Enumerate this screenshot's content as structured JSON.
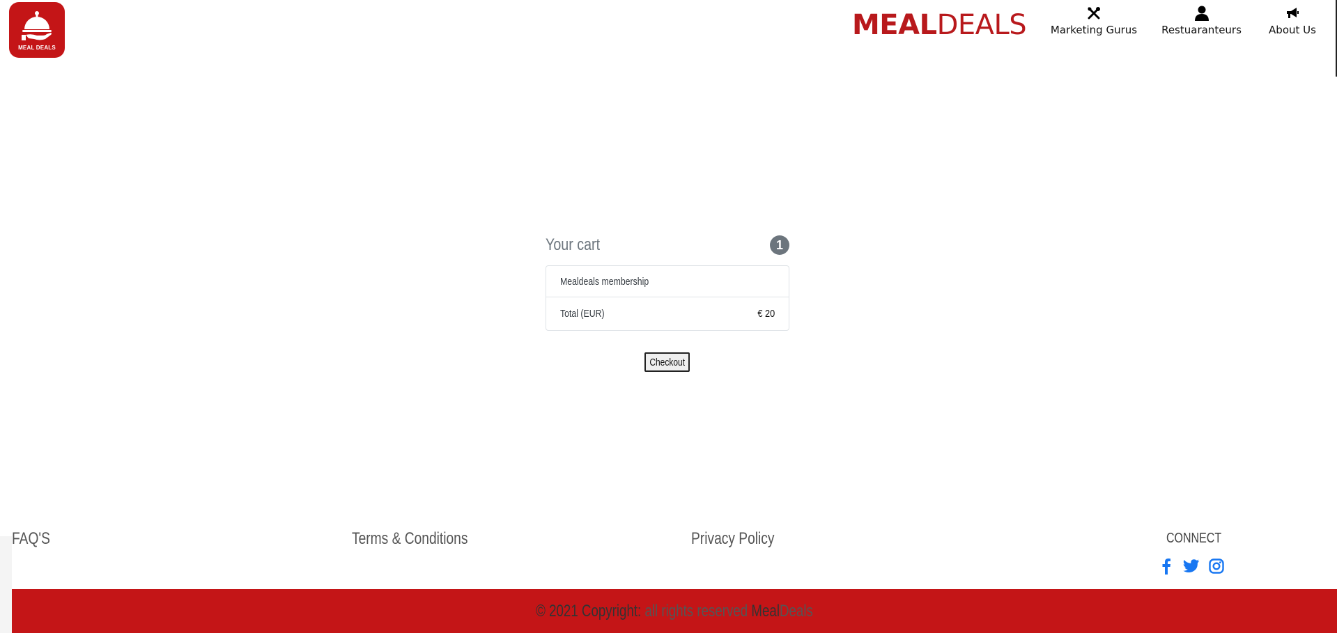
{
  "header": {
    "logo_text": "MEAL DEALS",
    "brand_part1": "MEAL",
    "brand_part2": "DEALS",
    "nav": [
      {
        "label": "Marketing Gurus",
        "icon": "tools-icon"
      },
      {
        "label": "Restuaranteurs",
        "icon": "user-icon"
      },
      {
        "label": "About Us",
        "icon": "megaphone-icon"
      }
    ]
  },
  "cart": {
    "title": "Your cart",
    "count": "1",
    "items": [
      {
        "name": "Mealdeals membership",
        "price": ""
      }
    ],
    "total_label": "Total (EUR)",
    "total_value": "€ 20",
    "checkout_label": "Checkout"
  },
  "footer": {
    "links": [
      "FAQ'S",
      "Terms & Conditions",
      "Privacy Policy"
    ],
    "connect_label": "CONNECT",
    "social_icons": [
      "facebook-icon",
      "twitter-icon",
      "instagram-icon"
    ],
    "copyright_prefix": "© 2021 Copyright:",
    "copyright_middle": "all rights reserved",
    "copyright_brand1": "Meal",
    "copyright_brand2": "Deals",
    "bar_color": "#c41517"
  },
  "colors": {
    "brand_red": "#b8191c",
    "link_blue": "#1877f2"
  }
}
